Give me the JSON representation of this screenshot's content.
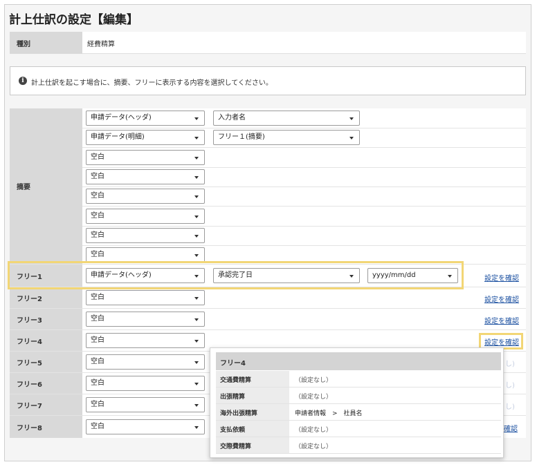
{
  "page": {
    "title": "計上仕訳の設定【編集】"
  },
  "kind": {
    "label": "種別",
    "value": "経費精算"
  },
  "info": {
    "icon": "info-icon",
    "text": "計上仕訳を起こす場合に、摘要、フリーに表示する内容を選択してください。"
  },
  "summary": {
    "label": "摘要",
    "rows": [
      [
        "申請データ(ヘッダ)",
        "入力者名"
      ],
      [
        "申請データ(明細)",
        "フリー１(摘要)"
      ],
      [
        "空白"
      ],
      [
        "空白"
      ],
      [
        "空白"
      ],
      [
        "空白"
      ],
      [
        "空白"
      ],
      [
        "空白"
      ]
    ]
  },
  "free_rows": [
    {
      "label": "フリー1",
      "selects": [
        "申請データ(ヘッダ)",
        "承認完了日",
        "yyyy/mm/dd"
      ],
      "link": "設定を確認"
    },
    {
      "label": "フリー2",
      "selects": [
        "空白"
      ],
      "link": "設定を確認"
    },
    {
      "label": "フリー3",
      "selects": [
        "空白"
      ],
      "link": "設定を確認"
    },
    {
      "label": "フリー4",
      "selects": [
        "空白"
      ],
      "link": "設定を確認"
    },
    {
      "label": "フリー5",
      "selects": [
        "空白"
      ],
      "link": "し)"
    },
    {
      "label": "フリー6",
      "selects": [
        "空白"
      ],
      "link": "し)"
    },
    {
      "label": "フリー7",
      "selects": [
        "空白"
      ],
      "link": "し)"
    },
    {
      "label": "フリー8",
      "selects": [
        "空白"
      ],
      "link": "確認"
    }
  ],
  "popup": {
    "title": "フリー4",
    "rows": [
      {
        "label": "交通費精算",
        "value": "（設定なし）"
      },
      {
        "label": "出張精算",
        "value": "（設定なし）"
      },
      {
        "label": "海外出張精算",
        "value": "申請者情報　>　社員名"
      },
      {
        "label": "支払依頼",
        "value": "（設定なし）"
      },
      {
        "label": "交際費精算",
        "value": "（設定なし）"
      }
    ]
  }
}
